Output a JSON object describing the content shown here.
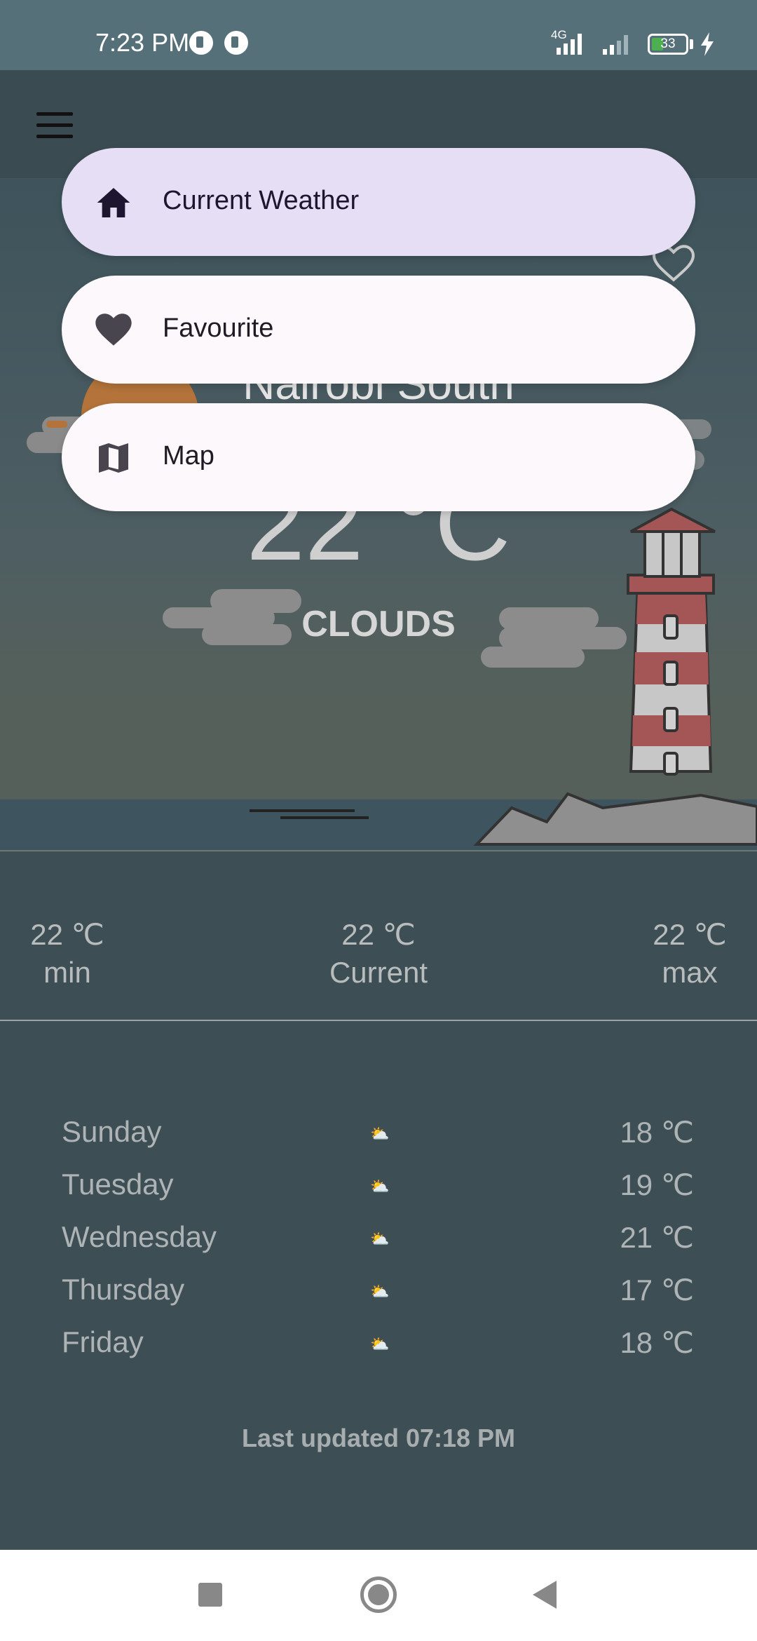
{
  "status_bar": {
    "time": "7:23 PM",
    "network": "4G",
    "battery": "33"
  },
  "app_bar": {
    "menu_icon": "hamburger-menu-icon"
  },
  "weather": {
    "city": "Nairobi South",
    "temperature": "22 °C",
    "condition": "CLOUDS"
  },
  "summary": {
    "min_value": "22 ℃",
    "min_label": "min",
    "current_value": "22 ℃",
    "current_label": "Current",
    "max_value": "22 ℃",
    "max_label": "max"
  },
  "forecast": [
    {
      "day": "Sunday",
      "icon": "⛅",
      "temp": "18 ℃"
    },
    {
      "day": "Tuesday",
      "icon": "⛅",
      "temp": "19 ℃"
    },
    {
      "day": "Wednesday",
      "icon": "⛅",
      "temp": "21 ℃"
    },
    {
      "day": "Thursday",
      "icon": "⛅",
      "temp": "17 ℃"
    },
    {
      "day": "Friday",
      "icon": "⛅",
      "temp": "18 ℃"
    }
  ],
  "last_updated": "Last updated 07:18 PM",
  "drawer": {
    "items": [
      {
        "label": "Current Weather",
        "icon": "home-icon",
        "selected": true
      },
      {
        "label": "Favourite",
        "icon": "heart-icon",
        "selected": false
      },
      {
        "label": "Map",
        "icon": "map-icon",
        "selected": false
      }
    ]
  },
  "colors": {
    "selected_item": "#e6def5",
    "menu_item": "#fdf8fc",
    "page_background": "#3d4f55"
  }
}
